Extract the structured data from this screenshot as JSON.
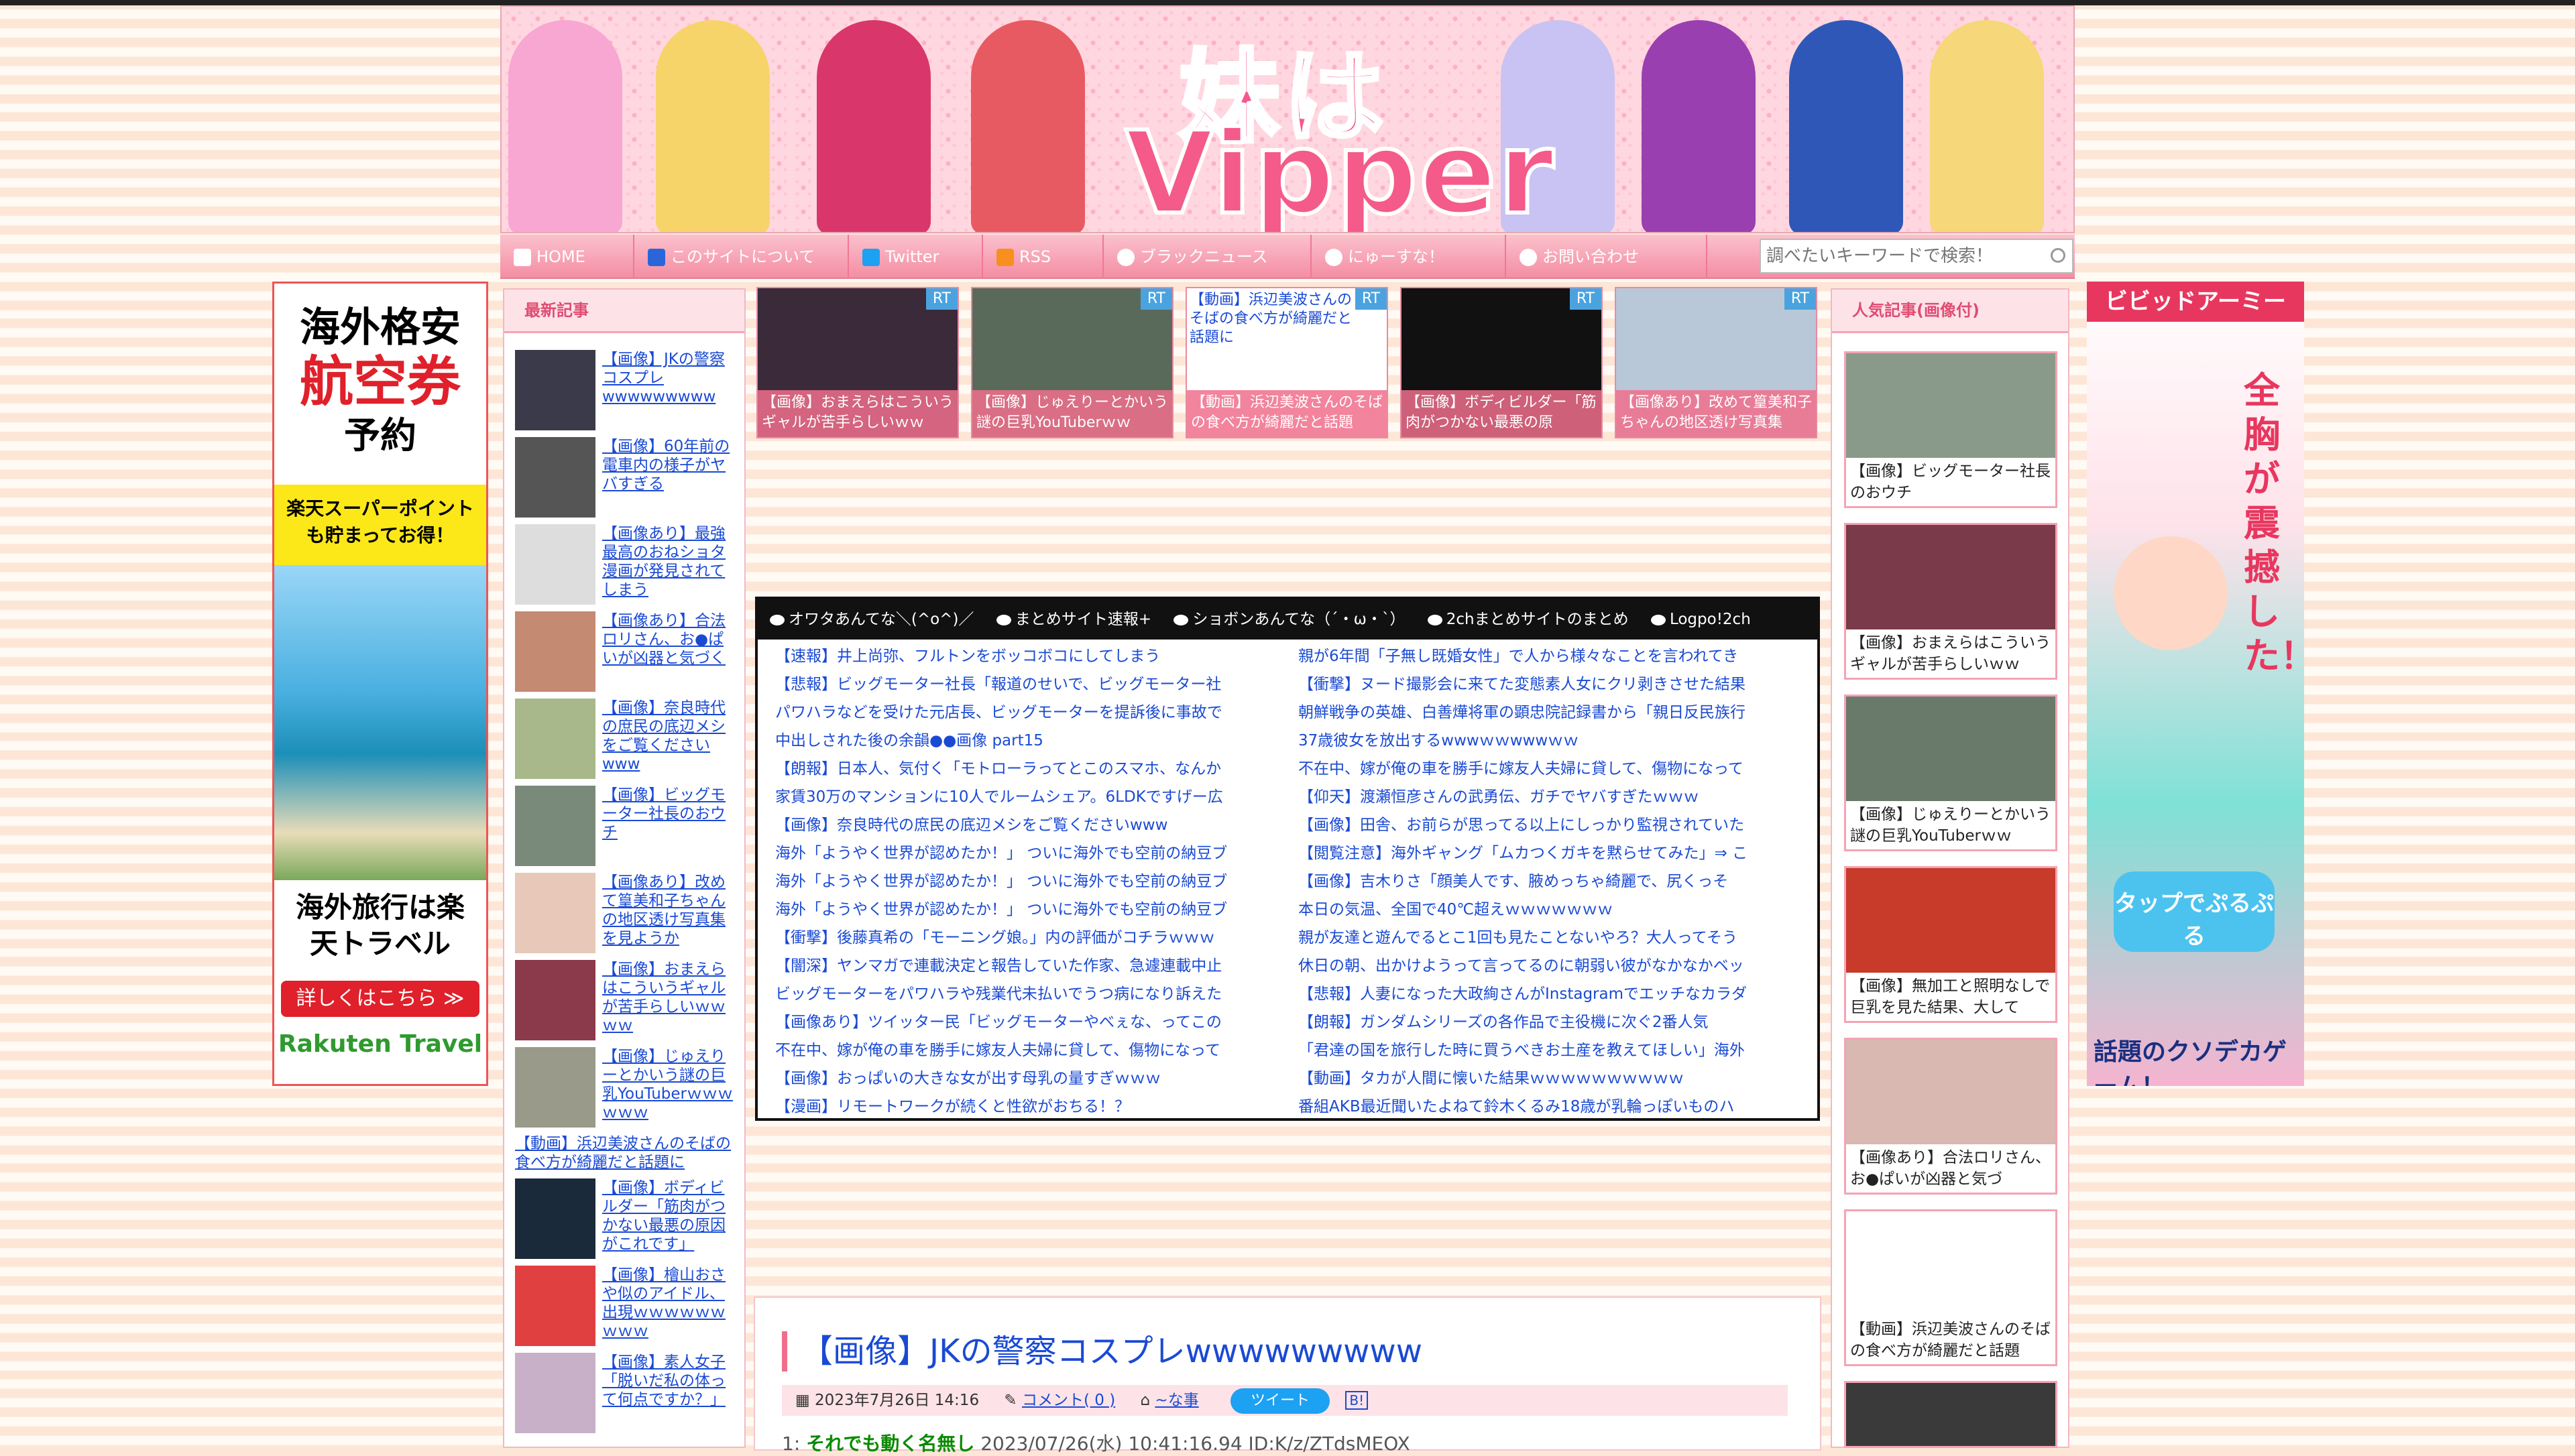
{
  "header": {
    "logo_line1": "妹は",
    "logo_line2": "Vipper"
  },
  "nav": {
    "items": [
      {
        "label": "HOME",
        "icon": "home-icon"
      },
      {
        "label": "このサイトについて",
        "icon": "info-icon"
      },
      {
        "label": "Twitter",
        "icon": "twitter-icon"
      },
      {
        "label": "RSS",
        "icon": "rss-icon"
      },
      {
        "label": "ブラックニュース",
        "icon": "face-icon"
      },
      {
        "label": "にゅーすな！",
        "icon": "face-icon"
      },
      {
        "label": "お問い合わせ",
        "icon": "mail-icon"
      }
    ],
    "search_placeholder": "調べたいキーワードで検索！"
  },
  "ad_left": {
    "line1": "海外格安",
    "line2": "航空券",
    "line3": "予約",
    "promo": "楽天スーパーポイントも貯まってお得！",
    "travel": "海外旅行は楽天トラベル",
    "cta": "詳しくはこちら ≫",
    "brand": "Rakuten Travel"
  },
  "ad_right": {
    "brand": "ビビッドアーミー",
    "catch": "全胸が震撼した！",
    "tap": "タップでぷるぷる",
    "foot": "話題のクソデカゲーム！"
  },
  "sidebar_left": {
    "title": "最新記事",
    "items": [
      "【画像】JKの警察コスプレwwwwwwwww",
      "【画像】60年前の電車内の様子がヤバすぎる",
      "【画像あり】最強最高のおねショタ漫画が発見されてしまう",
      "【画像あり】合法ロリさん、お●ぱいが凶器と気づく",
      "【画像】奈良時代の庶民の底辺メシをご覧くださいwww",
      "【画像】ビッグモーター社長のおウチ",
      "【画像あり】改めて篁美和子ちゃんの地区透け写真集を見ようか",
      "【画像】おまえらはこういうギャルが苦手らしいｗｗｗｗ",
      "【画像】じゅえりーとかいう謎の巨乳YouTuberｗｗｗｗｗｗ",
      "【動画】浜辺美波さんのそばの食べ方が綺麗だと話題に",
      "【画像】ボディビルダー「筋肉がつかない最悪の原因がこれです」",
      "【画像】檜山おさや似のアイドル、出現ｗｗｗｗｗｗｗｗｗ",
      "【画像】素人女子「脱いだ私の体って何点ですか？」"
    ]
  },
  "rt_items": [
    {
      "badge": "RT",
      "caption": "【画像】おまえらはこういうギャルが苦手らしいｗｗ"
    },
    {
      "badge": "RT",
      "caption": "【画像】じゅえりーとかいう謎の巨乳YouTuberｗｗ"
    },
    {
      "badge": "RT",
      "caption": "【動画】浜辺美波さんのそばの食べ方が綺麗だと話題",
      "overlay": "【動画】浜辺美波さんのそばの食べ方が綺麗だと話題に"
    },
    {
      "badge": "RT",
      "caption": "【画像】ボディビルダー「筋肉がつかない最悪の原"
    },
    {
      "badge": "RT",
      "caption": "【画像あり】改めて篁美和子ちゃんの地区透け写真集"
    }
  ],
  "feed": {
    "tabs": [
      "オワタあんてな＼(^o^)／",
      "まとめサイト速報+",
      "ショボンあんてな（´・ω・`）",
      "2chまとめサイトのまとめ",
      "Logpo!2ch"
    ],
    "left": [
      "【速報】井上尚弥、フルトンをボッコボコにしてしまう",
      "【悲報】ビッグモーター社長「報道のせいで、ビッグモーター社",
      "パワハラなどを受けた元店長、ビッグモーターを提訴後に事故で",
      "中出しされた後の余韻●●画像 part15",
      "【朗報】日本人、気付く「モトローラってとこのスマホ、なんか",
      "家賃30万のマンションに10人でルームシェア。6LDKですげー広",
      "【画像】奈良時代の庶民の底辺メシをご覧くださいwww",
      "海外「ようやく世界が認めたか！」 ついに海外でも空前の納豆ブ",
      "海外「ようやく世界が認めたか！」 ついに海外でも空前の納豆ブ",
      "海外「ようやく世界が認めたか！」 ついに海外でも空前の納豆ブ",
      "【衝撃】後藤真希の「モーニング娘。」内の評価がコチラｗｗｗ",
      "【闇深】ヤンマガで連載決定と報告していた作家、急遽連載中止",
      "ビッグモーターをパワハラや残業代未払いでうつ病になり訴えた",
      "【画像あり】ツイッター民「ビッグモーターやべぇな、ってこの",
      "不在中、嫁が俺の車を勝手に嫁友人夫婦に貸して、傷物になって",
      "【画像】おっぱいの大きな女が出す母乳の量すぎｗｗｗ",
      "【漫画】リモートワークが続くと性欲がおちる！？"
    ],
    "right": [
      "親が6年間「子無し既婚女性」で人から様々なことを言われてき",
      "【衝撃】ヌード撮影会に来てた変態素人女にクリ剥きさせた結果",
      "朝鮮戦争の英雄、白善燁将軍の顕忠院記録書から「親日反民族行",
      "37歳彼女を放出するwwwｗｗwwwｗｗ",
      "不在中、嫁が俺の車を勝手に嫁友人夫婦に貸して、傷物になって",
      "【仰天】渡瀬恒彦さんの武勇伝、ガチでヤバすぎたｗｗｗ",
      "【画像】田舎、お前らが思ってる以上にしっかり監視されていた",
      "【閲覧注意】海外ギャング「ムカつくガキを黙らせてみた」⇒ こ",
      "【画像】吉木りさ「顔美人です、腋めっちゃ綺麗で、尻くっそ",
      "本日の気温、全国で40℃超えｗｗｗｗｗｗｗ",
      "親が友達と遊んでるとこ1回も見たことないやろ？大人ってそう",
      "休日の朝、出かけようって言ってるのに朝弱い彼がなかなかベッ",
      "【悲報】人妻になった大政絢さんがInstagramでエッチなカラダ",
      "【朗報】ガンダムシリーズの各作品で主役機に次ぐ2番人気",
      "「君達の国を旅行した時に買うべきお土産を教えてほしい」海外",
      "【動画】タカが人間に懐いた結果ｗｗｗｗｗｗｗｗｗｗ",
      "番組AKB最近聞いたよねて鈴木くるみ18歳が乳輪っぽいものハ"
    ]
  },
  "article": {
    "title": "【画像】JKの警察コスプレwwwwwwwww",
    "date": "2023年7月26日 14:16",
    "comments": "コメント( 0 )",
    "category": "~な事",
    "tweet": "ツイート",
    "hatena": "B!",
    "first_num": "1:",
    "first_name": "それでも動く名無し",
    "first_meta": "2023/07/26(水) 10:41:16.94 ID:K/z/ZTdsMEOX"
  },
  "sidebar_right": {
    "title": "人気記事(画像付)",
    "items": [
      "【画像】ビッグモーター社長のおウチ",
      "【画像】おまえらはこういうギャルが苦手らしいｗｗ",
      "【画像】じゅえりーとかいう謎の巨乳YouTuberｗｗ",
      "【画像】無加工と照明なしで巨乳を見た結果、大して",
      "【画像あり】合法ロリさん、お●ぱいが凶器と気づ",
      "【動画】浜辺美波さんのそばの食べ方が綺麗だと話題"
    ]
  }
}
